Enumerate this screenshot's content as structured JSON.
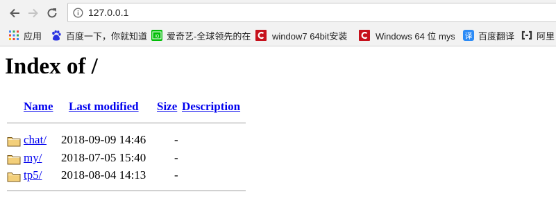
{
  "browser": {
    "url": "127.0.0.1",
    "bookmarks": [
      {
        "label": "应用",
        "icon": "apps-grid-icon"
      },
      {
        "label": "百度一下，你就知道",
        "icon": "baidu-paw-icon"
      },
      {
        "label": "爱奇艺-全球领先的在",
        "icon": "iqiyi-icon"
      },
      {
        "label": "window7 64bit安装",
        "icon": "red-c-icon"
      },
      {
        "label": "Windows 64 位 mys",
        "icon": "red-c-icon"
      },
      {
        "label": "百度翻译",
        "icon": "baidu-translate-icon"
      },
      {
        "label": "阿里",
        "icon": "aliyun-icon"
      }
    ]
  },
  "page": {
    "title": "Index of /",
    "columns": {
      "name": "Name",
      "last_modified": "Last modified",
      "size": "Size",
      "description": "Description"
    },
    "entries": [
      {
        "name": "chat/",
        "modified": "2018-09-09 14:46",
        "size": "-"
      },
      {
        "name": "my/",
        "modified": "2018-07-05 15:40",
        "size": "-"
      },
      {
        "name": "tp5/",
        "modified": "2018-08-04 14:13",
        "size": "-"
      }
    ]
  },
  "colors": {
    "link": "#0000ee",
    "chrome": "#f2f2f2"
  }
}
